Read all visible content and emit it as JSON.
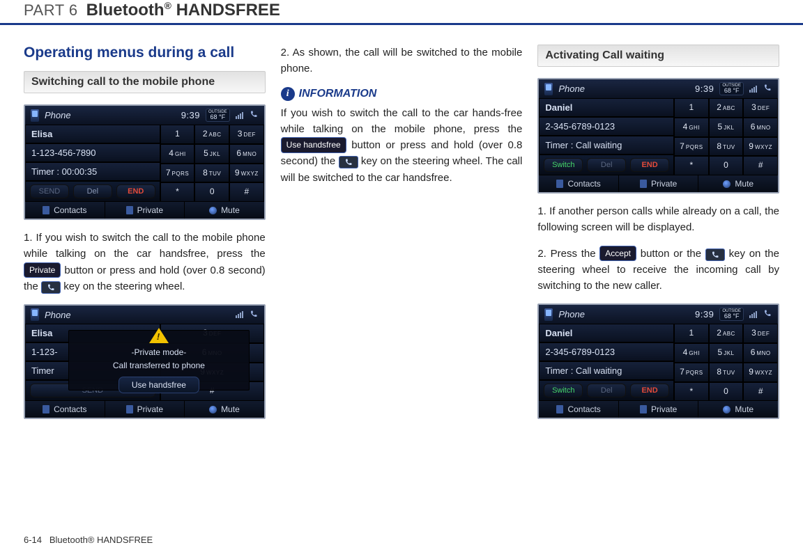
{
  "header": {
    "part": "PART 6",
    "title": "Bluetooth",
    "reg": "®",
    "title_suffix": " HANDSFREE"
  },
  "footer": {
    "page": "6-14",
    "label": "Bluetooth® HANDSFREE"
  },
  "col1": {
    "section_title": "Operating menus during a call",
    "sub_heading": "Switching call to the mobile phone",
    "screenshot1": {
      "status": {
        "app": "Phone",
        "clock": "9:39",
        "temp_top": "OUTSIDE",
        "temp_val": "68 °F"
      },
      "name": "Elisa",
      "number": "1-123-456-7890",
      "timer": "Timer : 00:00:35",
      "actions": {
        "send": "SEND",
        "del": "Del",
        "end": "END"
      },
      "keypad": [
        [
          "1",
          ""
        ],
        [
          "2",
          "ABC"
        ],
        [
          "3",
          "DEF"
        ],
        [
          "4",
          "GHI"
        ],
        [
          "5",
          "JKL"
        ],
        [
          "6",
          "MNO"
        ],
        [
          "7",
          "PQRS"
        ],
        [
          "8",
          "TUV"
        ],
        [
          "9",
          "WXYZ"
        ],
        [
          "*",
          ""
        ],
        [
          "0",
          ""
        ],
        [
          "#",
          ""
        ]
      ],
      "bottom": {
        "contacts": "Contacts",
        "private": "Private",
        "mute": "Mute"
      }
    },
    "para1_a": "1. If you wish to switch the call to the mobile phone while talking on the car handsfree, press the ",
    "btn_private": "Private",
    "para1_b": " button or press and hold (over 0.8 second) the ",
    "para1_c": " key on the steering wheel.",
    "screenshot2": {
      "status": {
        "app": "Phone"
      },
      "name": "Elisa",
      "number_short": "1-123-",
      "timer_short": "Timer",
      "send_short": "SEND",
      "overlay_line1": "-Private mode-",
      "overlay_line2": "Call transferred to phone",
      "overlay_btn": "Use handsfree",
      "right_keys": [
        [
          "3",
          "DEF"
        ],
        [
          "6",
          "MNO"
        ],
        [
          "9",
          "WXYZ"
        ],
        [
          "#",
          ""
        ]
      ],
      "bottom": {
        "contacts": "Contacts",
        "private": "Private",
        "mute": "Mute"
      }
    }
  },
  "col2": {
    "para2": "2. As shown, the call will be switched to the mobile phone.",
    "info_label": "INFORMATION",
    "info_a": "If you wish to switch the call to the car hands-free while talking on the mobile phone, press the ",
    "btn_usehf": "Use handsfree",
    "info_b": " button or press and hold (over 0.8 second) the ",
    "info_c": " key on the steering wheel. The call will be switched to the car handsfree."
  },
  "col3": {
    "sub_heading": "Activating Call waiting",
    "screenshot3": {
      "status": {
        "app": "Phone",
        "clock": "9:39",
        "temp_top": "OUTSIDE",
        "temp_val": "68 °F"
      },
      "name": "Daniel",
      "number": "2-345-6789-0123",
      "timer": "Timer : Call waiting",
      "actions": {
        "switch": "Switch",
        "del": "Del",
        "end": "END"
      },
      "keypad": [
        [
          "1",
          ""
        ],
        [
          "2",
          "ABC"
        ],
        [
          "3",
          "DEF"
        ],
        [
          "4",
          "GHI"
        ],
        [
          "5",
          "JKL"
        ],
        [
          "6",
          "MNO"
        ],
        [
          "7",
          "PQRS"
        ],
        [
          "8",
          "TUV"
        ],
        [
          "9",
          "WXYZ"
        ],
        [
          "*",
          ""
        ],
        [
          "0",
          ""
        ],
        [
          "#",
          ""
        ]
      ],
      "bottom": {
        "contacts": "Contacts",
        "private": "Private",
        "mute": "Mute"
      }
    },
    "para1": "1. If another person calls while already on a call, the following screen will be displayed.",
    "para2_a": "2. Press the ",
    "btn_accept": "Accept",
    "para2_b": " button or the ",
    "para2_c": " key on the steering wheel to receive the incoming call by switching to the new caller."
  }
}
